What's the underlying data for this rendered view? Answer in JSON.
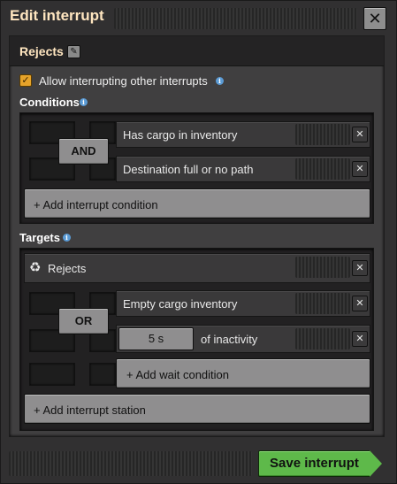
{
  "window": {
    "title": "Edit interrupt",
    "close_icon": "close-icon"
  },
  "interrupt": {
    "name": "Rejects",
    "rename_icon": "pencil-icon",
    "allow_interrupting": {
      "label": "Allow interrupting other interrupts",
      "checked": true
    }
  },
  "conditions": {
    "label": "Conditions",
    "logic": "AND",
    "items": [
      {
        "label": "Has cargo in inventory"
      },
      {
        "label": "Destination full or no path"
      }
    ],
    "add_label": "+ Add interrupt condition"
  },
  "targets": {
    "label": "Targets",
    "station": {
      "name": "Rejects",
      "icon": "recycle-icon",
      "logic": "OR",
      "wait_conditions": [
        {
          "label": "Empty cargo inventory"
        },
        {
          "value": "5 s",
          "label": "of inactivity"
        }
      ],
      "add_wait_label": "+ Add wait condition"
    },
    "add_station_label": "+ Add interrupt station"
  },
  "footer": {
    "save_label": "Save interrupt"
  },
  "colors": {
    "accent_green": "#5eb94a",
    "checkbox_orange": "#e6a32a",
    "title_color": "#ffe6c0"
  }
}
